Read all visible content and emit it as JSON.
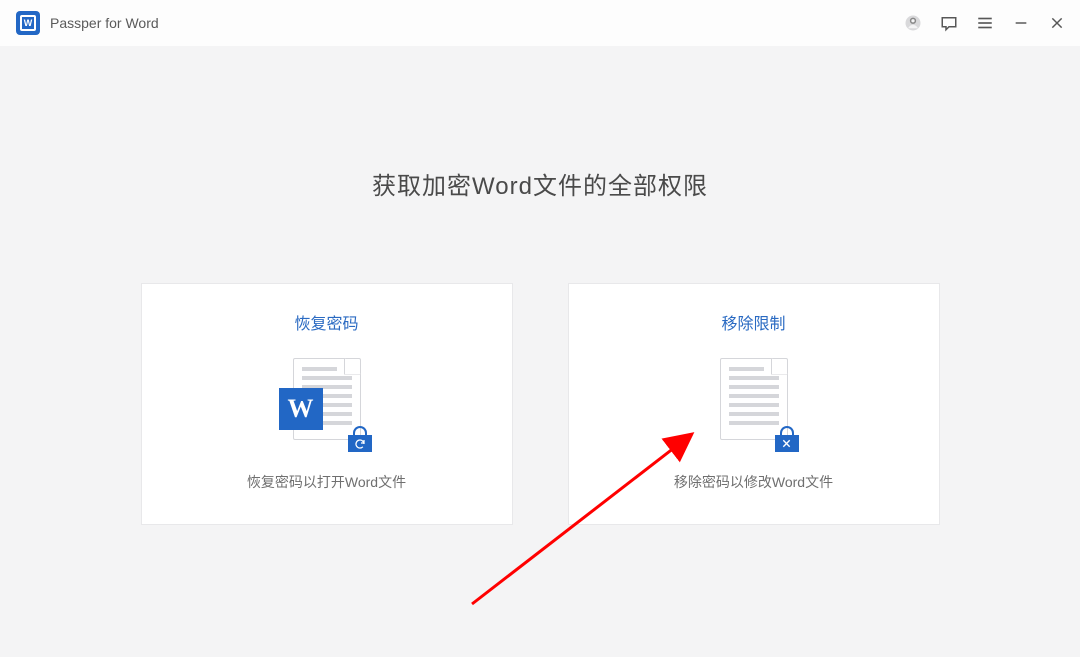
{
  "header": {
    "app_title": "Passper for Word",
    "logo_letter": "W"
  },
  "main": {
    "title": "获取加密Word文件的全部权限",
    "cards": [
      {
        "title": "恢复密码",
        "desc": "恢复密码以打开Word文件",
        "badge_letter": "W"
      },
      {
        "title": "移除限制",
        "desc": "移除密码以修改Word文件"
      }
    ]
  }
}
